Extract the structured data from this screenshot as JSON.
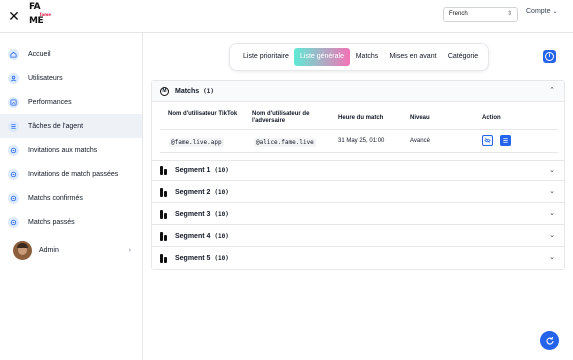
{
  "topbar": {
    "close_icon": "close-icon",
    "logo_text_top": "FA",
    "logo_text_mid": "fame",
    "logo_text_bottom": "ME",
    "language": "French",
    "account_label": "Compte"
  },
  "sidebar": {
    "items": [
      {
        "label": "Accueil",
        "icon": "home-icon"
      },
      {
        "label": "Utilisateurs",
        "icon": "user-icon"
      },
      {
        "label": "Performances",
        "icon": "chart-icon"
      },
      {
        "label": "Tâches de l'agent",
        "icon": "list-icon"
      },
      {
        "label": "Invitations aux matchs",
        "icon": "invite-icon"
      },
      {
        "label": "Invitations de match passées",
        "icon": "invite-past-icon"
      },
      {
        "label": "Matchs confirmés",
        "icon": "match-confirmed-icon"
      },
      {
        "label": "Matchs passés",
        "icon": "match-past-icon"
      }
    ],
    "active_index": 3,
    "admin_label": "Admin"
  },
  "tabs": [
    {
      "label": "Liste prioritaire"
    },
    {
      "label": "Liste générale"
    },
    {
      "label": "Matchs"
    },
    {
      "label": "Mises en avant"
    },
    {
      "label": "Catégorie"
    }
  ],
  "active_tab": 1,
  "matches": {
    "title": "Matchs",
    "count": "(1)",
    "columns": [
      "Nom d'utilisateur TikTok",
      "Nom d'utilisateur de l'adversaire",
      "Heure du match",
      "Niveau",
      "Action"
    ],
    "rows": [
      {
        "user": "@fame.live.app",
        "opponent": "@alice.fame.live",
        "time": "31 May 25, 01:00",
        "level": "Avancé"
      }
    ]
  },
  "segments": [
    {
      "title": "Segment 1",
      "count": "(10)"
    },
    {
      "title": "Segment 2",
      "count": "(10)"
    },
    {
      "title": "Segment 3",
      "count": "(10)"
    },
    {
      "title": "Segment 4",
      "count": "(10)"
    },
    {
      "title": "Segment 5",
      "count": "(10)"
    }
  ],
  "colors": {
    "accent": "#2563eb",
    "tab_gradient_start": "#5eead4",
    "tab_gradient_end": "#f472b6",
    "sidebar_active": "#eef2f7"
  }
}
